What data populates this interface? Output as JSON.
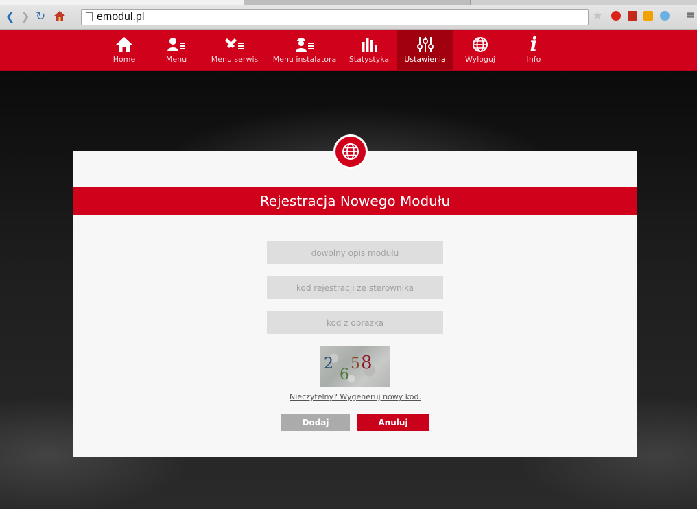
{
  "browser": {
    "url": "emodul.pl"
  },
  "nav": {
    "items": [
      {
        "label": "Home",
        "icon": "home-icon"
      },
      {
        "label": "Menu",
        "icon": "user-menu-icon"
      },
      {
        "label": "Menu serwis",
        "icon": "tools-icon"
      },
      {
        "label": "Menu instalatora",
        "icon": "installer-icon"
      },
      {
        "label": "Statystyka",
        "icon": "bar-chart-icon"
      },
      {
        "label": "Ustawienia",
        "icon": "sliders-icon",
        "active": true
      },
      {
        "label": "Wyloguj",
        "icon": "globe-icon"
      },
      {
        "label": "Info",
        "icon": "info-icon"
      }
    ]
  },
  "modal": {
    "title": "Rejestracja Nowego Modułu",
    "fields": {
      "description_placeholder": "dowolny opis modułu",
      "reg_code_placeholder": "kod rejestracji ze sterownika",
      "captcha_placeholder": "kod z obrazka"
    },
    "captcha_digits": [
      "2",
      "6",
      "5",
      "8"
    ],
    "regenerate_link": "Nieczytelny? Wygeneruj nowy kod.",
    "add_label": "Dodaj",
    "cancel_label": "Anuluj"
  },
  "colors": {
    "brand_red": "#d0011b",
    "active_red": "#a1000f",
    "button_gray": "#ababab"
  }
}
